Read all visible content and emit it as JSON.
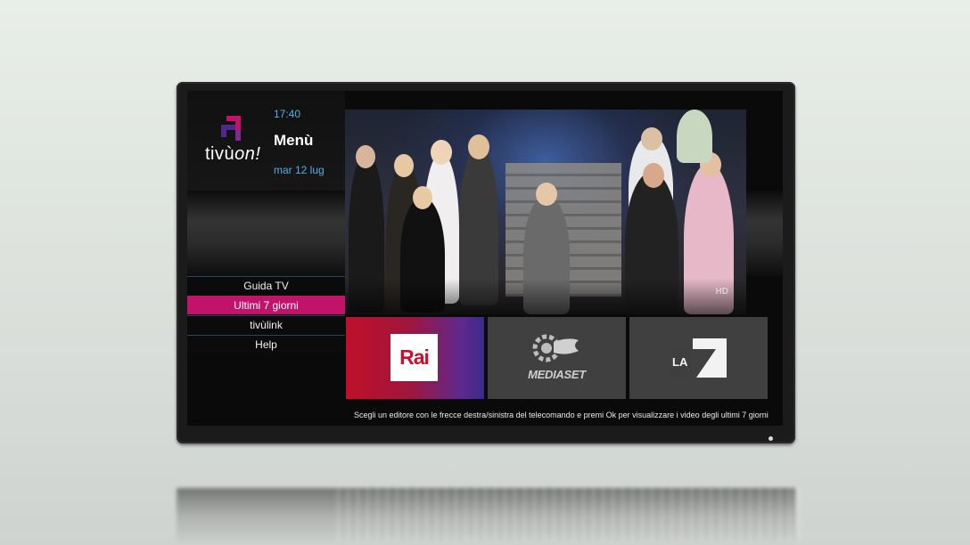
{
  "header": {
    "logo_text_main": "tivù",
    "logo_text_accent": "on!",
    "time": "17:40",
    "title": "Menù",
    "date": "mar 12 lug"
  },
  "menu": {
    "items": [
      {
        "label": "Guida TV",
        "active": false
      },
      {
        "label": "Ultimi 7 giorni",
        "active": true
      },
      {
        "label": "tivùlink",
        "active": false
      },
      {
        "label": "Help",
        "active": false
      }
    ]
  },
  "video": {
    "badge": "HD"
  },
  "channels": [
    {
      "name": "Rai",
      "logo_label": "Rai"
    },
    {
      "name": "Mediaset",
      "logo_label": "MEDIASET"
    },
    {
      "name": "La7",
      "logo_label": "LA7"
    }
  ],
  "hint": "Scegli un editore con le frecce destra/sinistra del telecomando e premi Ok per visualizzare i video degli ultimi 7 giorni",
  "colors": {
    "accent_pink": "#c2136a",
    "accent_blue": "#4fb0e6",
    "rai_red": "#c8102e"
  },
  "icons": {
    "brand": "tivuon-logo-icon",
    "power": "power-led-icon"
  }
}
